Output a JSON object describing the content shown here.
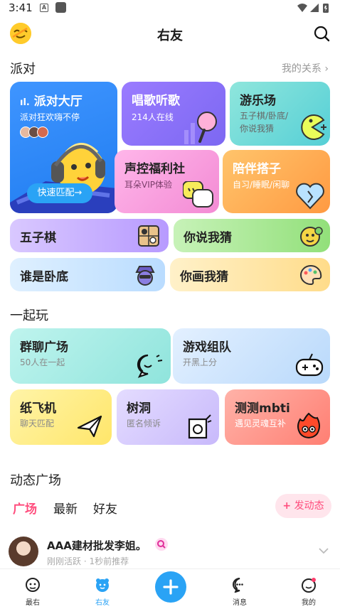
{
  "status_bar": {
    "time": "3:41",
    "a_icon": "A"
  },
  "header": {
    "title": "右友"
  },
  "party": {
    "title": "派对",
    "relations_link": "我的关系",
    "hall": {
      "title": "派对大厅",
      "subtitle": "派对狂欢嗨不停",
      "match_button": "快速匹配→"
    },
    "sing": {
      "title": "唱歌听歌",
      "subtitle": "214人在线"
    },
    "amusement": {
      "title": "游乐场",
      "subtitle_1": "五子棋/卧底/",
      "subtitle_2": "你说我猜"
    },
    "voice": {
      "title": "声控福利社",
      "subtitle": "耳朵VIP体验"
    },
    "companion": {
      "title": "陪伴搭子",
      "subtitle": "自习/睡眠/闲聊"
    },
    "gomoku": {
      "title": "五子棋"
    },
    "guess_say": {
      "title": "你说我猜"
    },
    "spy": {
      "title": "谁是卧底"
    },
    "draw_guess": {
      "title": "你画我猜"
    }
  },
  "play": {
    "title": "一起玩",
    "group_chat": {
      "title": "群聊广场",
      "subtitle": "50人在一起"
    },
    "game_team": {
      "title": "游戏组队",
      "subtitle": "开黑上分"
    },
    "paper_plane": {
      "title": "纸飞机",
      "subtitle": "聊天匹配"
    },
    "tree_hole": {
      "title": "树洞",
      "subtitle": "匿名倾诉"
    },
    "mbti": {
      "title": "测测mbti",
      "subtitle": "遇见灵魂互补"
    }
  },
  "feed": {
    "title": "动态广场",
    "tabs": [
      "广场",
      "最新",
      "好友"
    ],
    "post_button": "发动态",
    "post": {
      "username": "AAA建材批发李姐。",
      "meta": "刚刚活跃 · 1秒前推荐"
    }
  },
  "nav": {
    "items": [
      "最右",
      "右友",
      "",
      "消息",
      "我的"
    ]
  },
  "colors": {
    "accent_pink": "#ff4d7d",
    "accent_blue": "#2aa3f5",
    "hall_blue": "#2f8cf7"
  }
}
